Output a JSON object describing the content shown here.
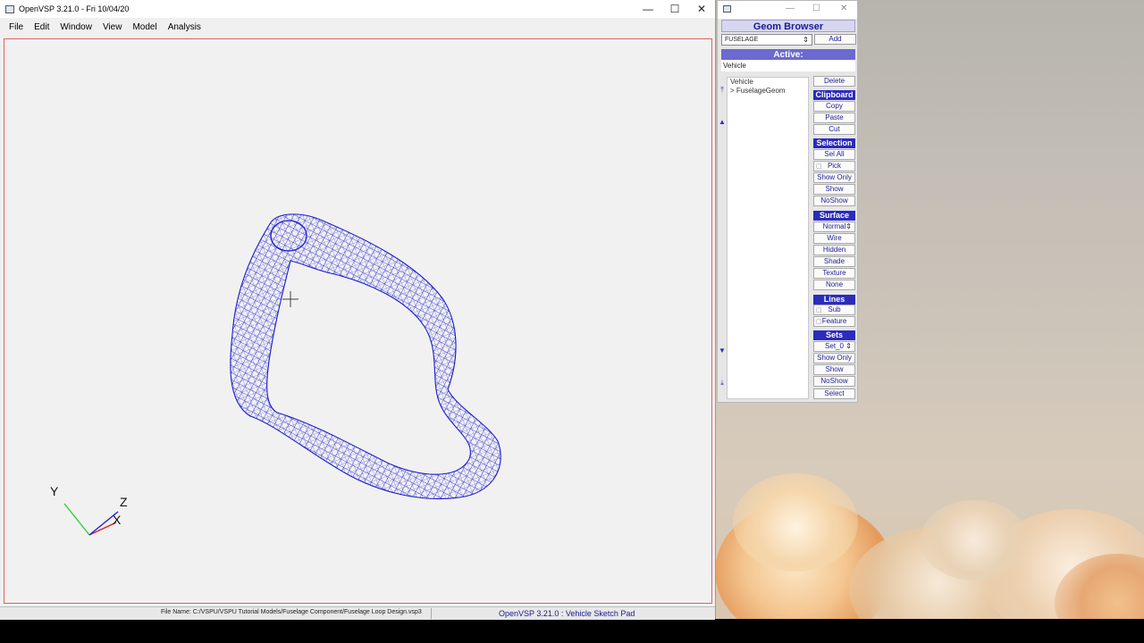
{
  "main_window": {
    "title": "OpenVSP 3.21.0 - Fri 10/04/20",
    "controls": {
      "minimize": "—",
      "maximize": "☐",
      "close": "✕"
    },
    "menu": [
      "File",
      "Edit",
      "Window",
      "View",
      "Model",
      "Analysis"
    ],
    "axes": {
      "y": "Y",
      "z": "Z",
      "x": "X"
    },
    "status": {
      "file_name": "File Name: C:/VSPU/VSPU Tutorial Models/Fuselage Component/Fuselage Loop Design.vsp3",
      "app": "OpenVSP 3.21.0 : Vehicle Sketch Pad"
    }
  },
  "geom_browser": {
    "window_controls": {
      "minimize": "—",
      "maximize": "☐",
      "close": "✕"
    },
    "title": "Geom Browser",
    "type_select": "FUSELAGE",
    "add_label": "Add",
    "active_label": "Active:",
    "active_value": "Vehicle",
    "tree": [
      "Vehicle",
      "> FuselageGeom"
    ],
    "delete_label": "Delete",
    "clipboard": {
      "header": "Clipboard",
      "buttons": [
        "Copy",
        "Paste",
        "Cut"
      ]
    },
    "selection": {
      "header": "Selection",
      "sel_all": "Sel All",
      "pick": "Pick",
      "show_only": "Show Only",
      "show": "Show",
      "noshow": "NoShow"
    },
    "surface": {
      "header": "Surface",
      "mode": "Normal",
      "buttons": [
        "Wire",
        "Hidden",
        "Shade",
        "Texture",
        "None"
      ]
    },
    "lines": {
      "header": "Lines",
      "sub": "Sub",
      "feature": "Feature"
    },
    "sets": {
      "header": "Sets",
      "set": "Set_0",
      "show_only": "Show Only",
      "show": "Show",
      "noshow": "NoShow",
      "select": "Select"
    }
  },
  "colors": {
    "wireframe": "#1a1ad0",
    "accent": "#2b2bbd",
    "axis_y": "#33cc33",
    "axis_x": "#e02020",
    "axis_z": "#2020e0"
  }
}
